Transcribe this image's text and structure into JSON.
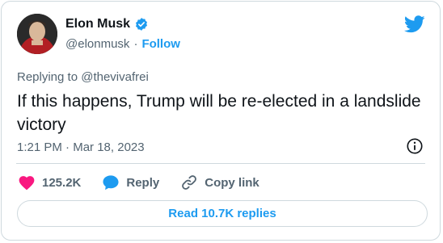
{
  "author": {
    "name": "Elon Musk",
    "handle": "@elonmusk",
    "separator": "·",
    "follow_label": "Follow"
  },
  "tweet": {
    "replying_to": "Replying to @thevivafrei",
    "text": "If this happens, Trump will be re-elected in a landslide victory",
    "time": "1:21 PM",
    "date_separator": "·",
    "date": "Mar 18, 2023"
  },
  "actions": {
    "likes_count": "125.2K",
    "reply_label": "Reply",
    "copy_link_label": "Copy link"
  },
  "replies_button": {
    "label": "Read 10.7K replies"
  },
  "icons": {
    "verified": "verified-badge-icon",
    "logo": "twitter-bird-icon",
    "info": "info-icon",
    "like": "heart-icon",
    "reply": "speech-bubble-icon",
    "copy_link": "link-icon"
  },
  "colors": {
    "accent": "#1d9bf0",
    "like": "#f91880",
    "text": "#0f1419",
    "muted": "#536471",
    "border": "#cfd9de"
  }
}
